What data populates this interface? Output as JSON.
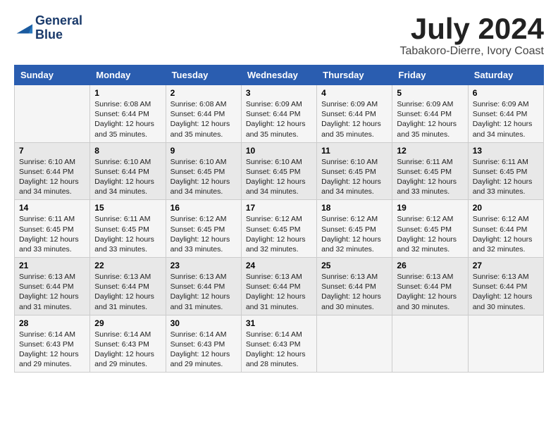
{
  "logo": {
    "line1": "General",
    "line2": "Blue"
  },
  "title": "July 2024",
  "subtitle": "Tabakoro-Dierre, Ivory Coast",
  "days_header": [
    "Sunday",
    "Monday",
    "Tuesday",
    "Wednesday",
    "Thursday",
    "Friday",
    "Saturday"
  ],
  "weeks": [
    [
      {
        "day": "",
        "sunrise": "",
        "sunset": "",
        "daylight": ""
      },
      {
        "day": "1",
        "sunrise": "Sunrise: 6:08 AM",
        "sunset": "Sunset: 6:44 PM",
        "daylight": "Daylight: 12 hours and 35 minutes."
      },
      {
        "day": "2",
        "sunrise": "Sunrise: 6:08 AM",
        "sunset": "Sunset: 6:44 PM",
        "daylight": "Daylight: 12 hours and 35 minutes."
      },
      {
        "day": "3",
        "sunrise": "Sunrise: 6:09 AM",
        "sunset": "Sunset: 6:44 PM",
        "daylight": "Daylight: 12 hours and 35 minutes."
      },
      {
        "day": "4",
        "sunrise": "Sunrise: 6:09 AM",
        "sunset": "Sunset: 6:44 PM",
        "daylight": "Daylight: 12 hours and 35 minutes."
      },
      {
        "day": "5",
        "sunrise": "Sunrise: 6:09 AM",
        "sunset": "Sunset: 6:44 PM",
        "daylight": "Daylight: 12 hours and 35 minutes."
      },
      {
        "day": "6",
        "sunrise": "Sunrise: 6:09 AM",
        "sunset": "Sunset: 6:44 PM",
        "daylight": "Daylight: 12 hours and 34 minutes."
      }
    ],
    [
      {
        "day": "7",
        "sunrise": "Sunrise: 6:10 AM",
        "sunset": "Sunset: 6:44 PM",
        "daylight": "Daylight: 12 hours and 34 minutes."
      },
      {
        "day": "8",
        "sunrise": "Sunrise: 6:10 AM",
        "sunset": "Sunset: 6:44 PM",
        "daylight": "Daylight: 12 hours and 34 minutes."
      },
      {
        "day": "9",
        "sunrise": "Sunrise: 6:10 AM",
        "sunset": "Sunset: 6:45 PM",
        "daylight": "Daylight: 12 hours and 34 minutes."
      },
      {
        "day": "10",
        "sunrise": "Sunrise: 6:10 AM",
        "sunset": "Sunset: 6:45 PM",
        "daylight": "Daylight: 12 hours and 34 minutes."
      },
      {
        "day": "11",
        "sunrise": "Sunrise: 6:10 AM",
        "sunset": "Sunset: 6:45 PM",
        "daylight": "Daylight: 12 hours and 34 minutes."
      },
      {
        "day": "12",
        "sunrise": "Sunrise: 6:11 AM",
        "sunset": "Sunset: 6:45 PM",
        "daylight": "Daylight: 12 hours and 33 minutes."
      },
      {
        "day": "13",
        "sunrise": "Sunrise: 6:11 AM",
        "sunset": "Sunset: 6:45 PM",
        "daylight": "Daylight: 12 hours and 33 minutes."
      }
    ],
    [
      {
        "day": "14",
        "sunrise": "Sunrise: 6:11 AM",
        "sunset": "Sunset: 6:45 PM",
        "daylight": "Daylight: 12 hours and 33 minutes."
      },
      {
        "day": "15",
        "sunrise": "Sunrise: 6:11 AM",
        "sunset": "Sunset: 6:45 PM",
        "daylight": "Daylight: 12 hours and 33 minutes."
      },
      {
        "day": "16",
        "sunrise": "Sunrise: 6:12 AM",
        "sunset": "Sunset: 6:45 PM",
        "daylight": "Daylight: 12 hours and 33 minutes."
      },
      {
        "day": "17",
        "sunrise": "Sunrise: 6:12 AM",
        "sunset": "Sunset: 6:45 PM",
        "daylight": "Daylight: 12 hours and 32 minutes."
      },
      {
        "day": "18",
        "sunrise": "Sunrise: 6:12 AM",
        "sunset": "Sunset: 6:45 PM",
        "daylight": "Daylight: 12 hours and 32 minutes."
      },
      {
        "day": "19",
        "sunrise": "Sunrise: 6:12 AM",
        "sunset": "Sunset: 6:45 PM",
        "daylight": "Daylight: 12 hours and 32 minutes."
      },
      {
        "day": "20",
        "sunrise": "Sunrise: 6:12 AM",
        "sunset": "Sunset: 6:44 PM",
        "daylight": "Daylight: 12 hours and 32 minutes."
      }
    ],
    [
      {
        "day": "21",
        "sunrise": "Sunrise: 6:13 AM",
        "sunset": "Sunset: 6:44 PM",
        "daylight": "Daylight: 12 hours and 31 minutes."
      },
      {
        "day": "22",
        "sunrise": "Sunrise: 6:13 AM",
        "sunset": "Sunset: 6:44 PM",
        "daylight": "Daylight: 12 hours and 31 minutes."
      },
      {
        "day": "23",
        "sunrise": "Sunrise: 6:13 AM",
        "sunset": "Sunset: 6:44 PM",
        "daylight": "Daylight: 12 hours and 31 minutes."
      },
      {
        "day": "24",
        "sunrise": "Sunrise: 6:13 AM",
        "sunset": "Sunset: 6:44 PM",
        "daylight": "Daylight: 12 hours and 31 minutes."
      },
      {
        "day": "25",
        "sunrise": "Sunrise: 6:13 AM",
        "sunset": "Sunset: 6:44 PM",
        "daylight": "Daylight: 12 hours and 30 minutes."
      },
      {
        "day": "26",
        "sunrise": "Sunrise: 6:13 AM",
        "sunset": "Sunset: 6:44 PM",
        "daylight": "Daylight: 12 hours and 30 minutes."
      },
      {
        "day": "27",
        "sunrise": "Sunrise: 6:13 AM",
        "sunset": "Sunset: 6:44 PM",
        "daylight": "Daylight: 12 hours and 30 minutes."
      }
    ],
    [
      {
        "day": "28",
        "sunrise": "Sunrise: 6:14 AM",
        "sunset": "Sunset: 6:43 PM",
        "daylight": "Daylight: 12 hours and 29 minutes."
      },
      {
        "day": "29",
        "sunrise": "Sunrise: 6:14 AM",
        "sunset": "Sunset: 6:43 PM",
        "daylight": "Daylight: 12 hours and 29 minutes."
      },
      {
        "day": "30",
        "sunrise": "Sunrise: 6:14 AM",
        "sunset": "Sunset: 6:43 PM",
        "daylight": "Daylight: 12 hours and 29 minutes."
      },
      {
        "day": "31",
        "sunrise": "Sunrise: 6:14 AM",
        "sunset": "Sunset: 6:43 PM",
        "daylight": "Daylight: 12 hours and 28 minutes."
      },
      {
        "day": "",
        "sunrise": "",
        "sunset": "",
        "daylight": ""
      },
      {
        "day": "",
        "sunrise": "",
        "sunset": "",
        "daylight": ""
      },
      {
        "day": "",
        "sunrise": "",
        "sunset": "",
        "daylight": ""
      }
    ]
  ]
}
